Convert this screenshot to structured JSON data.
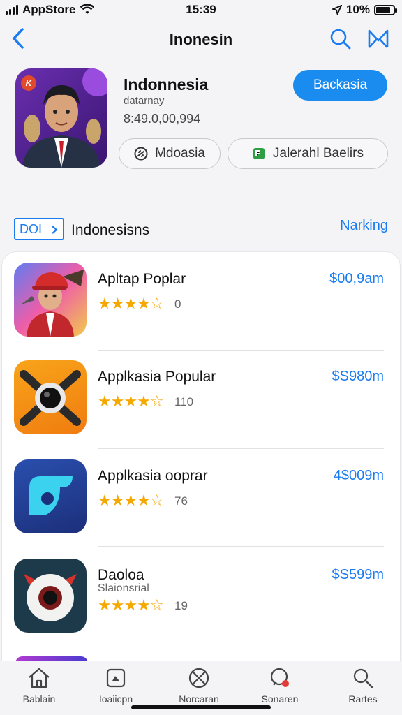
{
  "status": {
    "carrier": "AppStore",
    "time": "15:39",
    "battery": "10%",
    "battery_level": 0.85
  },
  "nav": {
    "title": "Inonesin"
  },
  "hero": {
    "name": "Indonnesia",
    "subtitle": "datarnay",
    "count": "8:49.0,00,994",
    "action_label": "Backasia",
    "chip1": "Mdoasia",
    "chip2": "Jalerahl Baelirs",
    "icon_badge": "K"
  },
  "section": {
    "tag": "DOI",
    "label": "Indonesisns",
    "link": "Narking"
  },
  "apps": [
    {
      "name": "Apltap Poplar",
      "subtitle": "",
      "stars": "★★★★☆",
      "rating_value": 4.5,
      "count": "0",
      "price": "$00,9am"
    },
    {
      "name": "Applkasia Popular",
      "subtitle": "",
      "stars": "★★★★☆",
      "rating_value": 4.5,
      "count": "110",
      "price": "$S980m"
    },
    {
      "name": "Applkasia ooprar",
      "subtitle": "",
      "stars": "★★★★☆",
      "rating_value": 4.5,
      "count": "76",
      "price": "4$009m"
    },
    {
      "name": "Daoloa",
      "subtitle": "Slaionsrial",
      "stars": "★★★★☆",
      "rating_value": 4.5,
      "count": "19",
      "price": "$S599m"
    }
  ],
  "tabs": [
    {
      "label": "Bablain",
      "icon": "home-icon"
    },
    {
      "label": "Ioaiicpn",
      "icon": "apps-icon"
    },
    {
      "label": "Norcaran",
      "icon": "games-icon"
    },
    {
      "label": "Sonaren",
      "icon": "arcade-icon"
    },
    {
      "label": "Rartes",
      "icon": "search-icon"
    }
  ],
  "colors": {
    "accent": "#1a7cf0",
    "star": "#f5a800",
    "button": "#1a8cf0"
  }
}
